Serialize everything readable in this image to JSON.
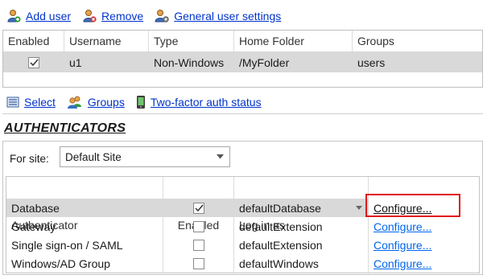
{
  "user_toolbar": {
    "add_user": "Add user",
    "remove": "Remove",
    "general_settings": "General user settings"
  },
  "users_table": {
    "columns": [
      "Enabled",
      "Username",
      "Type",
      "Home Folder",
      "Groups"
    ],
    "rows": [
      {
        "enabled": true,
        "username": "u1",
        "type": "Non-Windows",
        "home_folder": "/MyFolder",
        "groups": "users"
      }
    ]
  },
  "bottom_toolbar": {
    "select": "Select",
    "groups": "Groups",
    "two_factor": "Two-factor auth status"
  },
  "authenticators": {
    "title": "AUTHENTICATORS",
    "for_site_label": "For site:",
    "site_value": "Default Site",
    "columns": [
      "Authenticator",
      "Enabled",
      "Log in as",
      ""
    ],
    "rows": [
      {
        "name": "Database",
        "enabled": true,
        "login_as": "defaultDatabase",
        "action": "Configure...",
        "selected": true
      },
      {
        "name": "Gateway",
        "enabled": false,
        "login_as": "defaultExtension",
        "action": "Configure...",
        "selected": false
      },
      {
        "name": "Single sign-on / SAML",
        "enabled": false,
        "login_as": "defaultExtension",
        "action": "Configure...",
        "selected": false
      },
      {
        "name": "Windows/AD Group",
        "enabled": false,
        "login_as": "defaultWindows",
        "action": "Configure...",
        "selected": false
      }
    ]
  },
  "colors": {
    "link": "#0033cc",
    "configure_link": "#0066ee",
    "selected_row": "#d9d9d9",
    "highlight": "#e0191b"
  }
}
